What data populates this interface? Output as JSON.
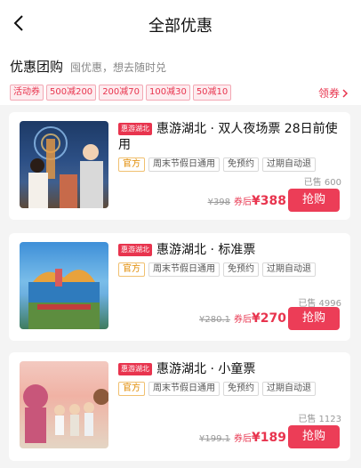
{
  "header": {
    "title": "全部优惠"
  },
  "section": {
    "title": "优惠团购",
    "subtitle": "囤优惠，想去随时兑",
    "coupon_label": "活动券",
    "coupons": [
      "500减200",
      "200减70",
      "100减30",
      "50减10"
    ],
    "get_coupon": "领券"
  },
  "products": [
    {
      "brand": "惠游湖北",
      "name": "惠游湖北 · 双人夜场票 28日前使用",
      "tags": [
        "官方",
        "周末节假日通用",
        "免预约",
        "过期自动退"
      ],
      "sold": "已售 600",
      "original_price": "¥398",
      "after_label": "券后",
      "price": "¥388",
      "buy_label": "抢购"
    },
    {
      "brand": "惠游湖北",
      "name": "惠游湖北 · 标准票",
      "tags": [
        "官方",
        "周末节假日通用",
        "免预约",
        "过期自动退"
      ],
      "sold": "已售 4996",
      "original_price": "¥280.1",
      "after_label": "券后",
      "price": "¥270",
      "buy_label": "抢购"
    },
    {
      "brand": "惠游湖北",
      "name": "惠游湖北 · 小童票",
      "tags": [
        "官方",
        "周末节假日通用",
        "免预约",
        "过期自动退"
      ],
      "sold": "已售 1123",
      "original_price": "¥199.1",
      "after_label": "券后",
      "price": "¥189",
      "buy_label": "抢购"
    }
  ],
  "colors": {
    "accent": "#ec3d57",
    "tag_official": "#e08a00"
  }
}
